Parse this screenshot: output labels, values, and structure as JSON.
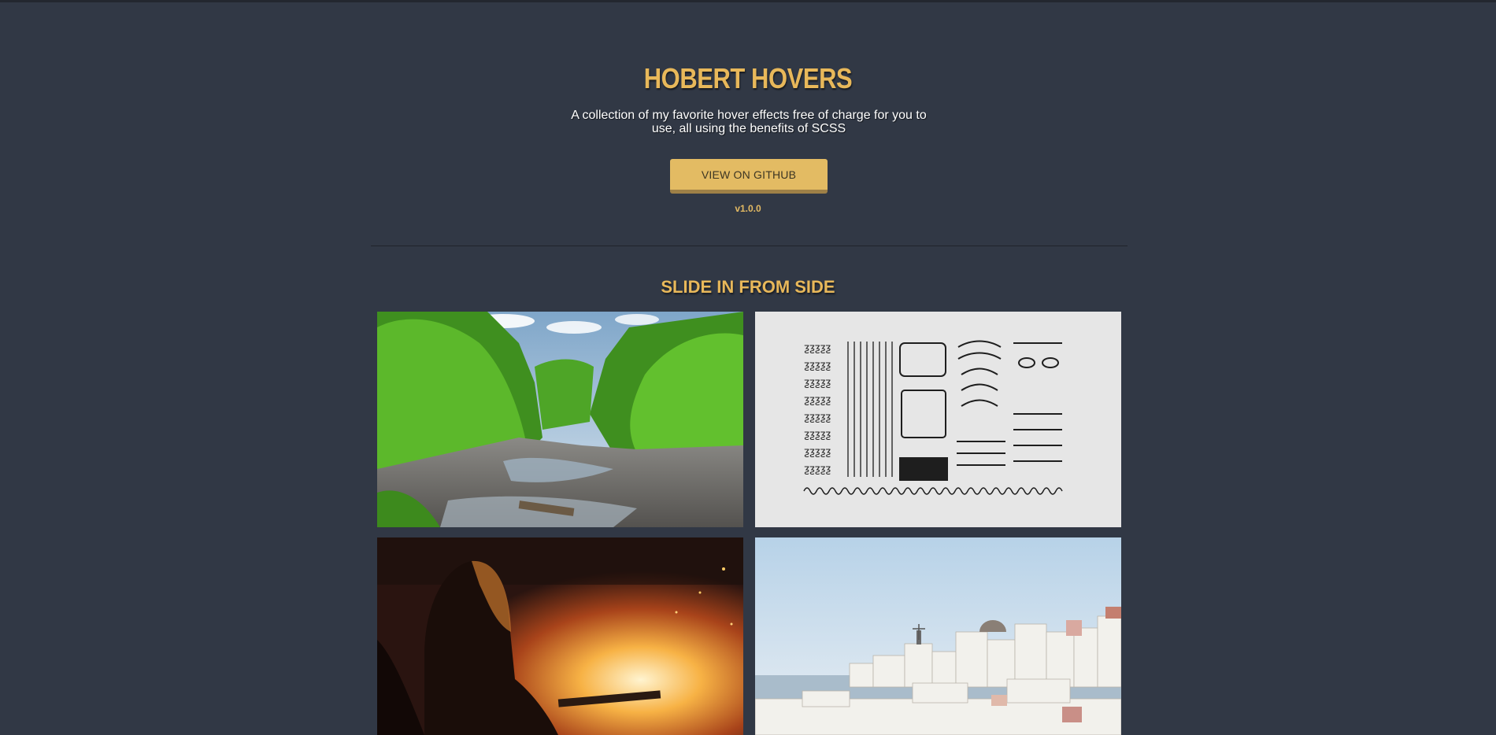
{
  "header": {
    "title": "HOBERT HOVERS",
    "tagline": "A collection of my favorite hover effects free of charge for you to use, all using the benefits of SCSS",
    "github_button_label": "VIEW ON GITHUB",
    "version": "v1.0.0"
  },
  "sections": [
    {
      "title": "SLIDE IN FROM SIDE",
      "tiles": [
        {
          "image": "forest-river-photo"
        },
        {
          "image": "disassembled-typewriter-parts-photo"
        },
        {
          "image": "girl-by-bonfire-photo"
        },
        {
          "image": "santorini-village-photo"
        }
      ]
    }
  ],
  "colors": {
    "background": "#313845",
    "accent": "#e8b85a",
    "button": "#e3bb63",
    "button_shadow": "#9e8047"
  }
}
